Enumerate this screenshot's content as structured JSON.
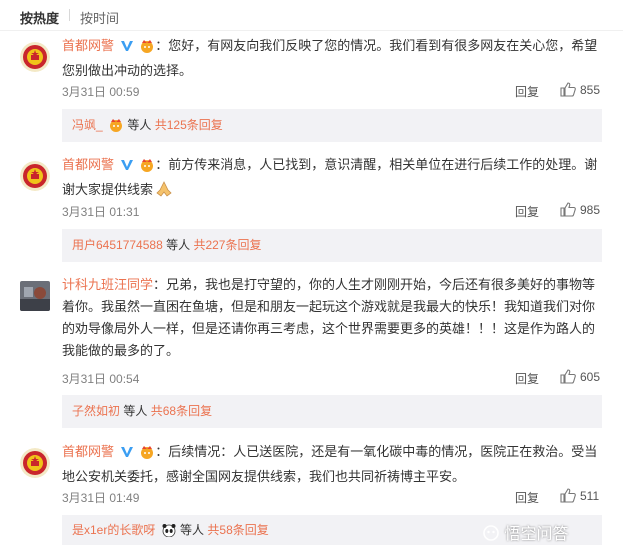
{
  "sort": {
    "hot": "按热度",
    "time": "按时间"
  },
  "reply_label": "回复",
  "others_label": "等人",
  "comments": [
    {
      "user": "首都网警",
      "text": "：您好，有网友向我们反映了您的情况。我们看到有很多网友在关心您，希望您别做出冲动的选择。",
      "time": "3月31日 00:59",
      "likes": "855",
      "sub_user": "冯飒_",
      "sub_count": "共125条回复"
    },
    {
      "user": "首都网警",
      "text": "：前方传来消息，人已找到，意识清醒，相关单位在进行后续工作的处理。谢谢大家提供线索",
      "time": "3月31日 01:31",
      "likes": "985",
      "sub_user": "用户6451774588",
      "sub_count": "共227条回复"
    },
    {
      "user": "计科九班汪同学",
      "text": "：兄弟，我也是打守望的，你的人生才刚刚开始，今后还有很多美好的事物等着你。我虽然一直困在鱼塘，但是和朋友一起玩这个游戏就是我最大的快乐！我知道我们对你的劝导像局外人一样，但是还请你再三考虑，这个世界需要更多的英雄！！！这是作为路人的我能做的最多的了。",
      "time": "3月31日 00:54",
      "likes": "605",
      "sub_user": "子然如初",
      "sub_count": "共68条回复"
    },
    {
      "user": "首都网警",
      "text": "：后续情况：人已送医院，还是有一氧化碳中毒的情况，医院正在救治。受当地公安机关委托，感谢全国网友提供线索，我们也共同祈祷博主平安。",
      "time": "3月31日 01:49",
      "likes": "511",
      "sub_user": "是x1er的长歌呀",
      "sub_count": "共58条回复"
    }
  ],
  "watermark": "悟空问答",
  "colors": {
    "link": "#eb7350",
    "sub_bg": "#f2f2f5",
    "vip": "#f6a623",
    "verified": "#3b9ef2"
  }
}
